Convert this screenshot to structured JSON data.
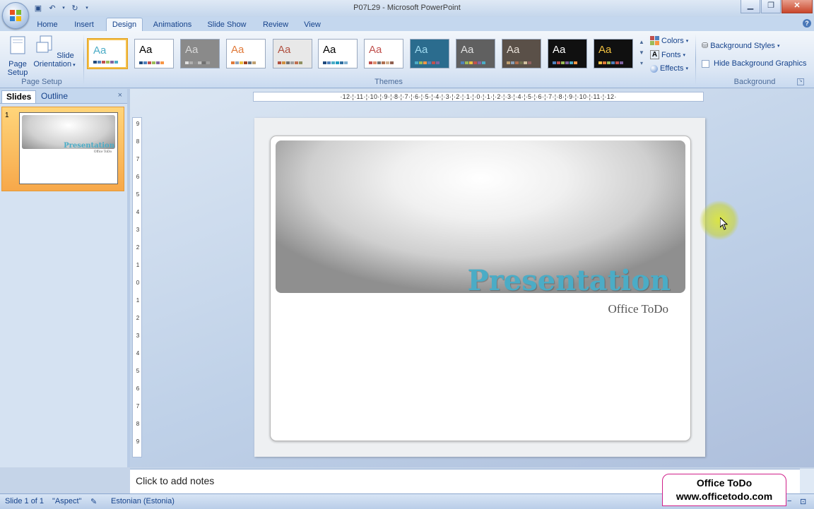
{
  "window": {
    "title": "P07L29 - Microsoft PowerPoint"
  },
  "tabs": [
    "Home",
    "Insert",
    "Design",
    "Animations",
    "Slide Show",
    "Review",
    "View"
  ],
  "active_tab": "Design",
  "ribbon": {
    "page_setup": {
      "page_setup_label": "Page Setup",
      "orientation_label": "Slide Orientation",
      "group_label": "Page Setup"
    },
    "themes": {
      "group_label": "Themes",
      "items": [
        {
          "label": "Aa",
          "bg": "#ffffff",
          "fg": "#4bacc6",
          "bars": [
            "#1f497d",
            "#4f81bd",
            "#c0504d",
            "#9bbb59",
            "#8064a2",
            "#4bacc6"
          ]
        },
        {
          "label": "Aa",
          "bg": "#ffffff",
          "fg": "#000000",
          "bars": [
            "#1f497d",
            "#4f81bd",
            "#c0504d",
            "#9bbb59",
            "#8064a2",
            "#f79646"
          ]
        },
        {
          "label": "Aa",
          "bg": "#8a8a8a",
          "fg": "#d8d8d8",
          "bars": [
            "#e0e0e0",
            "#b0b0b0",
            "#909090",
            "#c0c0c0",
            "#707070",
            "#a0a0a0"
          ]
        },
        {
          "label": "Aa",
          "bg": "#ffffff",
          "fg": "#e07a3a",
          "bars": [
            "#e07a3a",
            "#8aa0b8",
            "#f0c040",
            "#a04020",
            "#607080",
            "#c0a070"
          ]
        },
        {
          "label": "Aa",
          "bg": "#e8e8e8",
          "fg": "#b05040",
          "bars": [
            "#b05040",
            "#d09040",
            "#707070",
            "#a0a0a0",
            "#c07050",
            "#909060"
          ]
        },
        {
          "label": "Aa",
          "bg": "#ffffff",
          "fg": "#000000",
          "bars": [
            "#1f497d",
            "#4f81bd",
            "#4bacc6",
            "#1f9bc0",
            "#2e6ea0",
            "#7fb0d0"
          ]
        },
        {
          "label": "Aa",
          "bg": "#ffffff",
          "fg": "#c0504d",
          "bars": [
            "#c0504d",
            "#e09070",
            "#707070",
            "#b07050",
            "#d0b090",
            "#906050"
          ]
        },
        {
          "label": "Aa",
          "bg": "#2b6c8e",
          "fg": "#9fdaf0",
          "bars": [
            "#4bacc6",
            "#9bbb59",
            "#f79646",
            "#4f81bd",
            "#c0504d",
            "#8064a2"
          ]
        },
        {
          "label": "Aa",
          "bg": "#606060",
          "fg": "#e0e0e0",
          "bars": [
            "#4f81bd",
            "#9bbb59",
            "#f0c040",
            "#c0504d",
            "#8064a2",
            "#4bacc6"
          ]
        },
        {
          "label": "Aa",
          "bg": "#5a5048",
          "fg": "#e8e0d8",
          "bars": [
            "#c0a070",
            "#8aa0b8",
            "#b07050",
            "#707050",
            "#d0c0a0",
            "#906060"
          ]
        },
        {
          "label": "Aa",
          "bg": "#101010",
          "fg": "#ffffff",
          "bars": [
            "#4f81bd",
            "#c0504d",
            "#9bbb59",
            "#8064a2",
            "#4bacc6",
            "#f79646"
          ]
        },
        {
          "label": "Aa",
          "bg": "#101010",
          "fg": "#f0c040",
          "bars": [
            "#f0c040",
            "#e07a3a",
            "#9bbb59",
            "#4f81bd",
            "#c0504d",
            "#8064a2"
          ]
        }
      ]
    },
    "colors_label": "Colors",
    "fonts_label": "Fonts",
    "effects_label": "Effects",
    "background": {
      "styles_label": "Background Styles",
      "hide_label": "Hide Background Graphics",
      "group_label": "Background"
    }
  },
  "left_panel": {
    "tab_slides": "Slides",
    "tab_outline": "Outline",
    "close": "×",
    "slide_number": "1",
    "thumb_title": "Presentation",
    "thumb_subtitle": "Office ToDo"
  },
  "ruler": {
    "h_text": "·12·¦·11·¦·10·¦·9·¦·8·¦·7·¦·6·¦·5·¦·4·¦·3·¦·2·¦·1·¦·0·¦·1·¦·2·¦·3·¦·4·¦·5·¦·6·¦·7·¦·8·¦·9·¦·10·¦·11·¦·12·",
    "v_labels": [
      "9",
      "8",
      "7",
      "6",
      "5",
      "4",
      "3",
      "2",
      "1",
      "0",
      "1",
      "2",
      "3",
      "4",
      "5",
      "6",
      "7",
      "8",
      "9"
    ]
  },
  "slide": {
    "title": "Presentation",
    "subtitle": "Office ToDo"
  },
  "notes": {
    "placeholder": "Click to add notes"
  },
  "status": {
    "slide_count": "Slide 1 of 1",
    "theme": "\"Aspect\"",
    "language": "Estonian (Estonia)"
  },
  "watermark": {
    "line1": "Office ToDo",
    "line2": "www.officetodo.com"
  },
  "colors": {
    "accent": "#4bacc6",
    "ribbon_bg": "#dbe6f4"
  }
}
